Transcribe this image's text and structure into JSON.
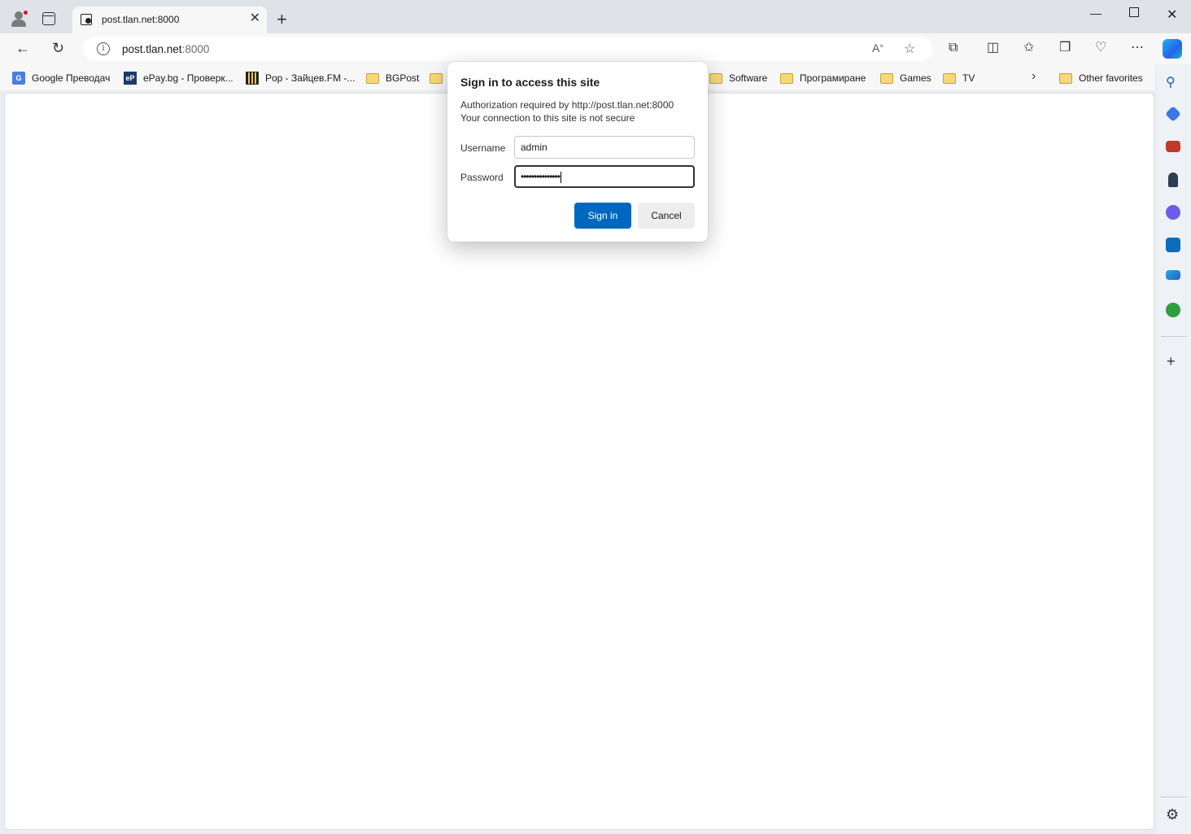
{
  "window": {
    "minimize_icon": "minimize-icon",
    "maximize_icon": "maximize-icon",
    "close_icon": "close-icon"
  },
  "tab": {
    "title": "post.tlan.net:8000"
  },
  "address_bar": {
    "host": "post.tlan.net",
    "port": ":8000"
  },
  "favorites": [
    {
      "label": "Google Преводач",
      "icon": "google-translate-icon"
    },
    {
      "label": "ePay.bg - Проверк...",
      "icon": "epay-icon"
    },
    {
      "label": "Pop - Зайцев.FM -...",
      "icon": "zaycev-fm-icon"
    },
    {
      "label": "BGPost",
      "icon": "folder-icon"
    },
    {
      "label": "",
      "icon": "folder-icon"
    },
    {
      "label": "Software",
      "icon": "folder-icon"
    },
    {
      "label": "Програмиране",
      "icon": "folder-icon"
    },
    {
      "label": "Games",
      "icon": "folder-icon"
    },
    {
      "label": "TV",
      "icon": "folder-icon"
    },
    {
      "label": "Other favorites",
      "icon": "folder-icon"
    }
  ],
  "dialog": {
    "title": "Sign in to access this site",
    "message_line1": "Authorization required by http://post.tlan.net:8000",
    "message_line2": "Your connection to this site is not secure",
    "username_label": "Username",
    "username_value": "admin",
    "password_label": "Password",
    "password_value": "•••••••••••••••",
    "sign_in_label": "Sign in",
    "cancel_label": "Cancel"
  },
  "colors": {
    "primary_button": "#0067c0",
    "titlebar": "#dfe3e8",
    "toolbar": "#f7f7f7"
  }
}
